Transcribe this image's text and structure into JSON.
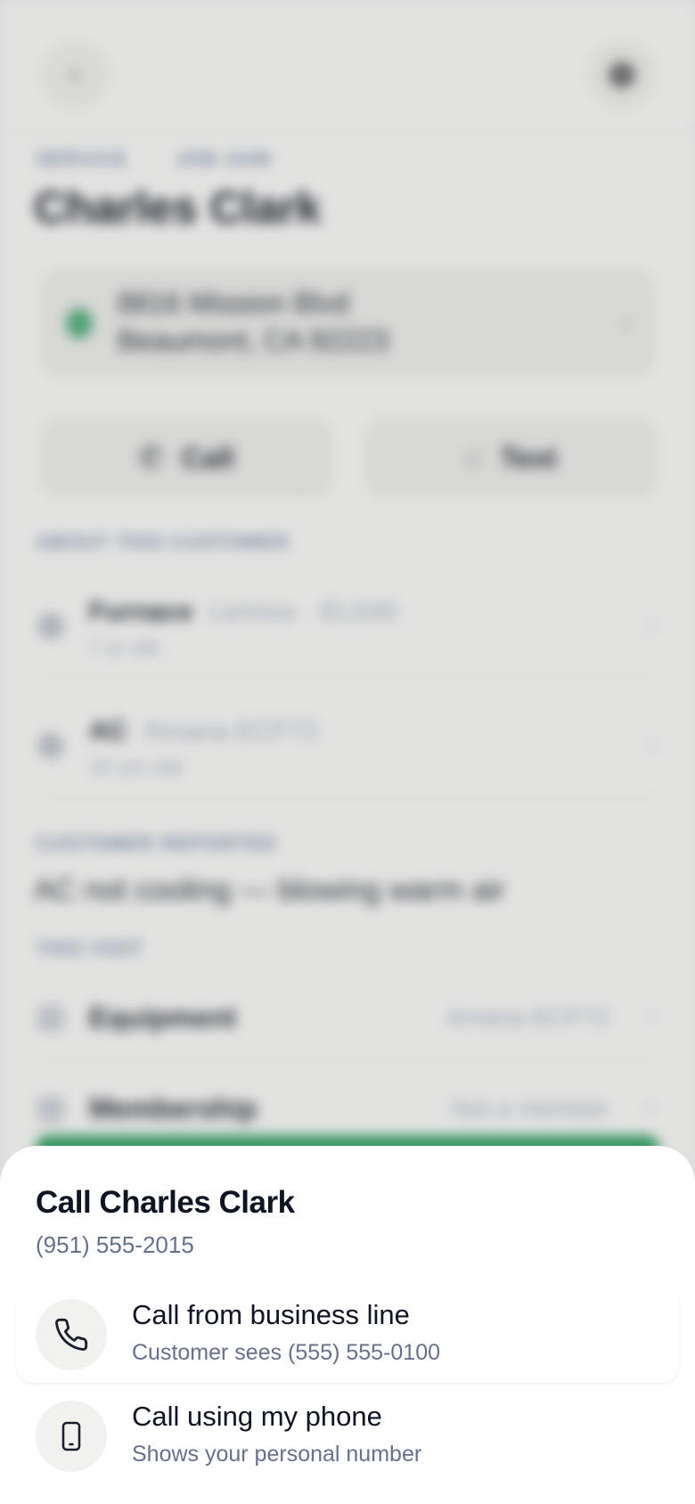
{
  "background": {
    "breadcrumbs": [
      "SERVICE",
      "JOB 1048"
    ],
    "customer_name": "Charles Clark",
    "address": {
      "line1": "8816 Mission Blvd",
      "line2": "Beaumont, CA 92223"
    },
    "actions": {
      "call_label": "Call",
      "text_label": "Text"
    },
    "about_section_label": "ABOUT THIS CUSTOMER",
    "equipment": [
      {
        "name": "Furnace",
        "model": "Lennox · EL540",
        "age": "7 yr old"
      },
      {
        "name": "AC",
        "model": "Amana ECF72",
        "age": "10 yrs old"
      }
    ],
    "reported_section_label": "CUSTOMER REPORTED",
    "reported_text": "AC not cooling — blowing warm air",
    "this_visit_label": "THIS VISIT",
    "visit_rows": [
      {
        "name": "Equipment",
        "value": "Amana ECF72"
      },
      {
        "name": "Membership",
        "value": "Not a member"
      }
    ]
  },
  "sheet": {
    "title": "Call Charles Clark",
    "phone": "(951) 555-2015",
    "options": [
      {
        "label": "Call from business line",
        "sub": "Customer sees (555) 555-0100",
        "icon": "phone-icon"
      },
      {
        "label": "Call using my phone",
        "sub": "Shows your personal number",
        "icon": "mobile-icon"
      }
    ]
  },
  "colors": {
    "accent_green": "#2f9a5e",
    "text_primary": "#101523",
    "text_secondary": "#68708a"
  }
}
